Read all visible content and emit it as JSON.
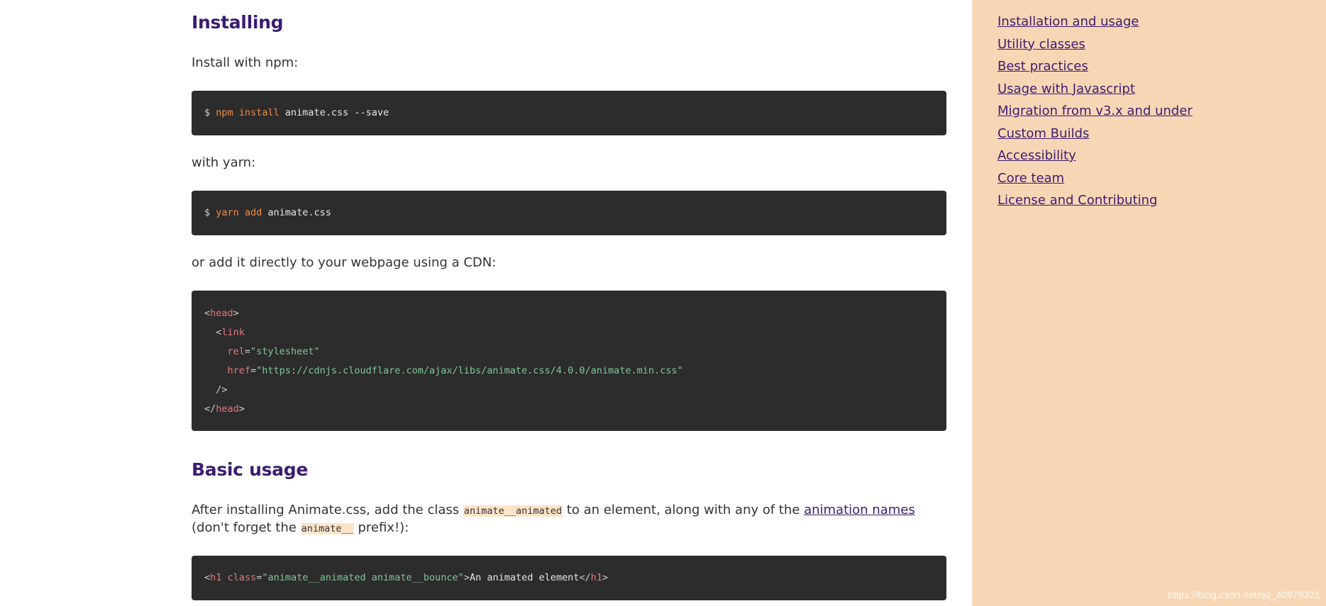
{
  "installing": {
    "heading": "Installing",
    "npm_intro": "Install with npm:",
    "npm_prompt": "$ ",
    "npm_cmd": "npm install",
    "npm_args": " animate.css --save",
    "yarn_intro": "with yarn:",
    "yarn_prompt": "$ ",
    "yarn_cmd": "yarn add",
    "yarn_args": " animate.css",
    "cdn_intro": "or add it directly to your webpage using a CDN:",
    "cdn_code": {
      "head_tag": "head",
      "link_tag": "link",
      "rel_attr": "rel",
      "rel_val": "\"stylesheet\"",
      "href_attr": "href",
      "href_val": "\"https://cdnjs.cloudflare.com/ajax/libs/animate.css/4.0.0/animate.min.css\""
    }
  },
  "basic_usage": {
    "heading": "Basic usage",
    "text_1": "After installing Animate.css, add the class ",
    "code_1": "animate__animated",
    "text_2": " to an element, along with any of the ",
    "link": "animation names",
    "text_3": "(don't forget the ",
    "code_2": "animate__",
    "text_4": " prefix!):",
    "example": {
      "tag": "h1",
      "attr": "class",
      "val": "\"animate__animated animate__bounce\"",
      "content": "An animated element"
    }
  },
  "sidebar": {
    "items": [
      {
        "label": "Installation and usage"
      },
      {
        "label": "Utility classes"
      },
      {
        "label": "Best practices"
      },
      {
        "label": "Usage with Javascript"
      },
      {
        "label": "Migration from v3.x and under"
      },
      {
        "label": "Custom Builds"
      },
      {
        "label": "Accessibility"
      },
      {
        "label": "Core team"
      },
      {
        "label": "License and Contributing"
      }
    ]
  },
  "watermark": "https://blog.csdn.net/qq_40976321"
}
